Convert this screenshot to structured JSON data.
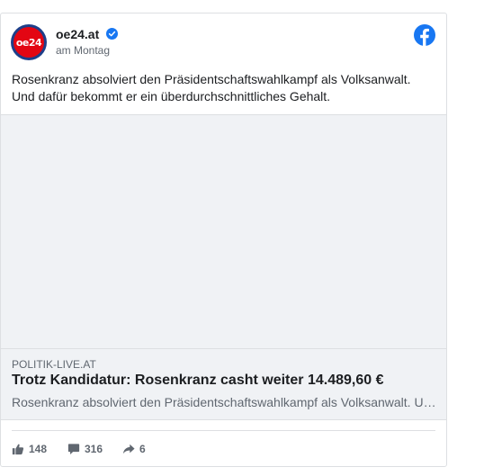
{
  "post": {
    "page_name": "oe24.at",
    "avatar_text": "oe24",
    "timestamp": "am Montag",
    "text_line1": "Rosenkranz absolviert den Präsidentschaftswahlkampf als Volksanwalt.",
    "text_line2": "Und dafür bekommt er ein überdurchschnittliches Gehalt."
  },
  "link_preview": {
    "domain": "POLITIK-LIVE.AT",
    "title": "Trotz Kandidatur: Rosenkranz casht weiter 14.489,60 €",
    "description": "Rosenkranz absolviert den Präsidentschaftswahlkampf als Volksanwalt. Und dafür bekommt er ein überdurchschnittliches Gehalt."
  },
  "actions": {
    "likes": "148",
    "comments": "316",
    "shares": "6"
  },
  "icons": {
    "verified": "verified-badge-icon",
    "brand": "facebook-logo-icon",
    "like": "thumbs-up-icon",
    "comment": "comment-bubble-icon",
    "share": "share-arrow-icon"
  },
  "colors": {
    "facebook_blue": "#1877f2",
    "avatar_red": "#e30613",
    "avatar_ring": "#1d3f8a",
    "secondary_text": "#606770",
    "preview_bg": "#f0f2f5"
  }
}
